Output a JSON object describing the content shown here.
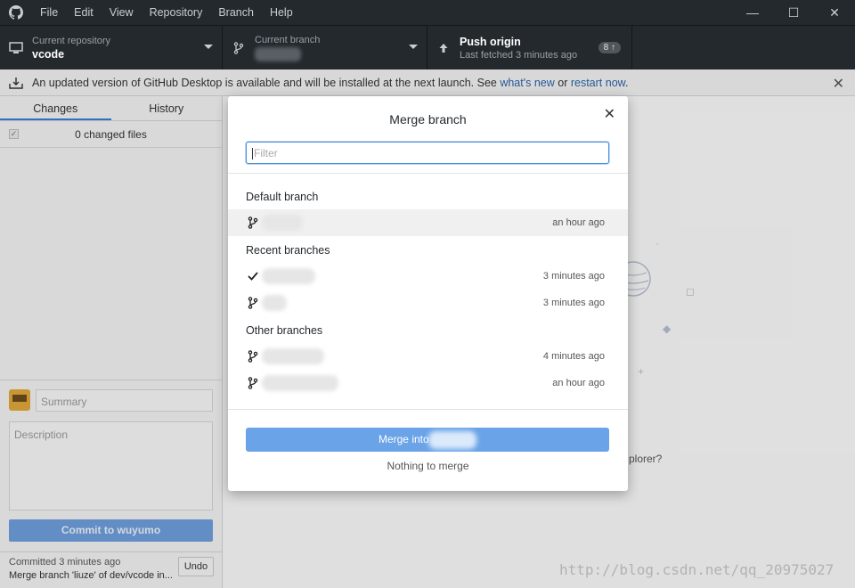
{
  "menu": [
    "File",
    "Edit",
    "View",
    "Repository",
    "Branch",
    "Help"
  ],
  "window_controls": {
    "minimize": "—",
    "maximize": "☐",
    "close": "✕"
  },
  "toolbar": {
    "repo_label": "Current repository",
    "repo_value": "vcode",
    "branch_label": "Current branch",
    "push_label": "Push origin",
    "push_sub": "Last fetched 3 minutes ago",
    "push_badge": "8 ↑"
  },
  "banner": {
    "text": "An updated version of GitHub Desktop is available and will be installed at the next launch. See ",
    "link1": "what's new",
    "mid": " or ",
    "link2": "restart now",
    "end": "."
  },
  "left": {
    "tab_changes": "Changes",
    "tab_history": "History",
    "changed_files": "0 changed files",
    "summary_placeholder": "Summary",
    "description_placeholder": "Description",
    "commit_prefix": "Commit to ",
    "commit_branch": "wuyumo",
    "last_commit_time": "Committed 3 minutes ago",
    "last_commit_msg": "Merge branch 'liuze' of dev/vcode in...",
    "undo": "Undo"
  },
  "background": {
    "partial_text": "plorer?",
    "watermark": "http://blog.csdn.net/qq_20975027"
  },
  "modal": {
    "title": "Merge branch",
    "filter_placeholder": "Filter",
    "default_section": "Default branch",
    "recent_section": "Recent branches",
    "other_section": "Other branches",
    "rows": [
      {
        "time": "an hour ago"
      },
      {
        "time": "3 minutes ago"
      },
      {
        "time": "3 minutes ago"
      },
      {
        "time": "4 minutes ago"
      },
      {
        "time": "an hour ago"
      }
    ],
    "merge_button": "Merge into",
    "nothing_to_merge": "Nothing to merge"
  }
}
